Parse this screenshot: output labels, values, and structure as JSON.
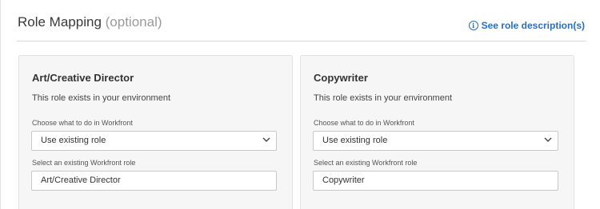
{
  "header": {
    "title": "Role Mapping",
    "optional": "(optional)",
    "description_link": "See role description(s)"
  },
  "cards": [
    {
      "role_name": "Art/Creative Director",
      "status": "This role exists in your environment",
      "action_label": "Choose what to do in Workfront",
      "action_value": "Use existing role",
      "existing_label": "Select an existing Workfront role",
      "existing_value": "Art/Creative Director"
    },
    {
      "role_name": "Copywriter",
      "status": "This role exists in your environment",
      "action_label": "Choose what to do in Workfront",
      "action_value": "Use existing role",
      "existing_label": "Select an existing Workfront role",
      "existing_value": "Copywriter"
    }
  ],
  "colors": {
    "link": "#2a6fb8",
    "card_background": "#f6f6f6",
    "border": "#c8c8c8"
  },
  "icons": {
    "description_link": "info-icon",
    "select": "chevron-down-icon"
  }
}
